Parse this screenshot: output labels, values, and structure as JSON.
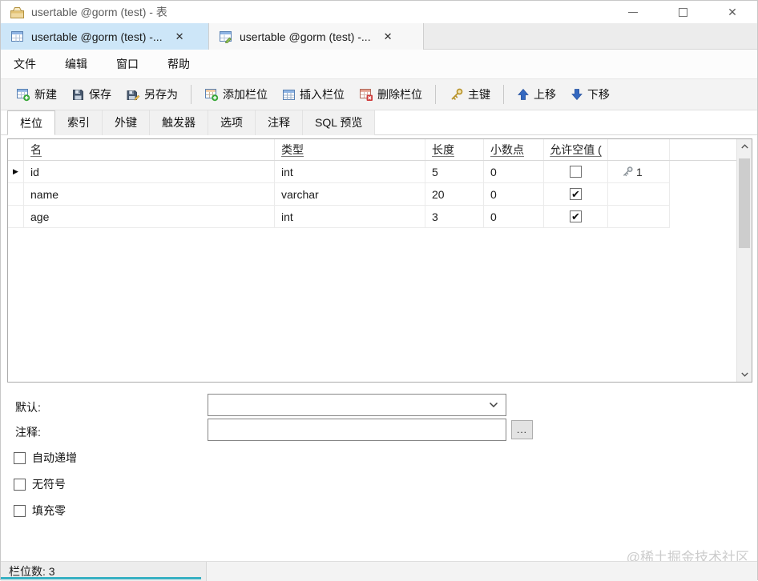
{
  "window": {
    "title": "usertable @gorm (test) - 表"
  },
  "doc_tabs": [
    {
      "label": "usertable @gorm (test) -...",
      "close": "✕",
      "active": true
    },
    {
      "label": "usertable @gorm (test) -...",
      "close": "✕",
      "active": false
    }
  ],
  "menu": {
    "items": [
      "文件",
      "编辑",
      "窗口",
      "帮助"
    ]
  },
  "toolbar": {
    "buttons": [
      {
        "label": "新建"
      },
      {
        "label": "保存"
      },
      {
        "label": "另存为"
      },
      {
        "label": "添加栏位"
      },
      {
        "label": "插入栏位"
      },
      {
        "label": "删除栏位"
      },
      {
        "label": "主键"
      },
      {
        "label": "上移"
      },
      {
        "label": "下移"
      }
    ]
  },
  "subtabs": {
    "items": [
      "栏位",
      "索引",
      "外键",
      "触发器",
      "选项",
      "注释",
      "SQL 预览"
    ],
    "active_index": 0
  },
  "grid": {
    "columns": {
      "name": "名",
      "type": "类型",
      "length": "长度",
      "decimal": "小数点",
      "nullable": "允许空值 (",
      "key": ""
    },
    "rows": [
      {
        "name": "id",
        "type": "int",
        "length": "5",
        "decimal": "0",
        "nullable": false,
        "key_order": "1",
        "selected": true
      },
      {
        "name": "name",
        "type": "varchar",
        "length": "20",
        "decimal": "0",
        "nullable": true,
        "key_order": "",
        "selected": false
      },
      {
        "name": "age",
        "type": "int",
        "length": "3",
        "decimal": "0",
        "nullable": true,
        "key_order": "",
        "selected": false
      }
    ]
  },
  "form": {
    "default_label": "默认:",
    "default_value": "",
    "comment_label": "注释:",
    "comment_value": "",
    "browse_label": "...",
    "checkboxes": [
      "自动递增",
      "无符号",
      "填充零"
    ]
  },
  "statusbar": {
    "text": "栏位数: 3"
  },
  "watermark": "@稀土掘金技术社区",
  "colors": {
    "active_doc_tab": "#cde6f8",
    "accent_bar": "#38b1c3",
    "key_gold": "#b9952e"
  }
}
